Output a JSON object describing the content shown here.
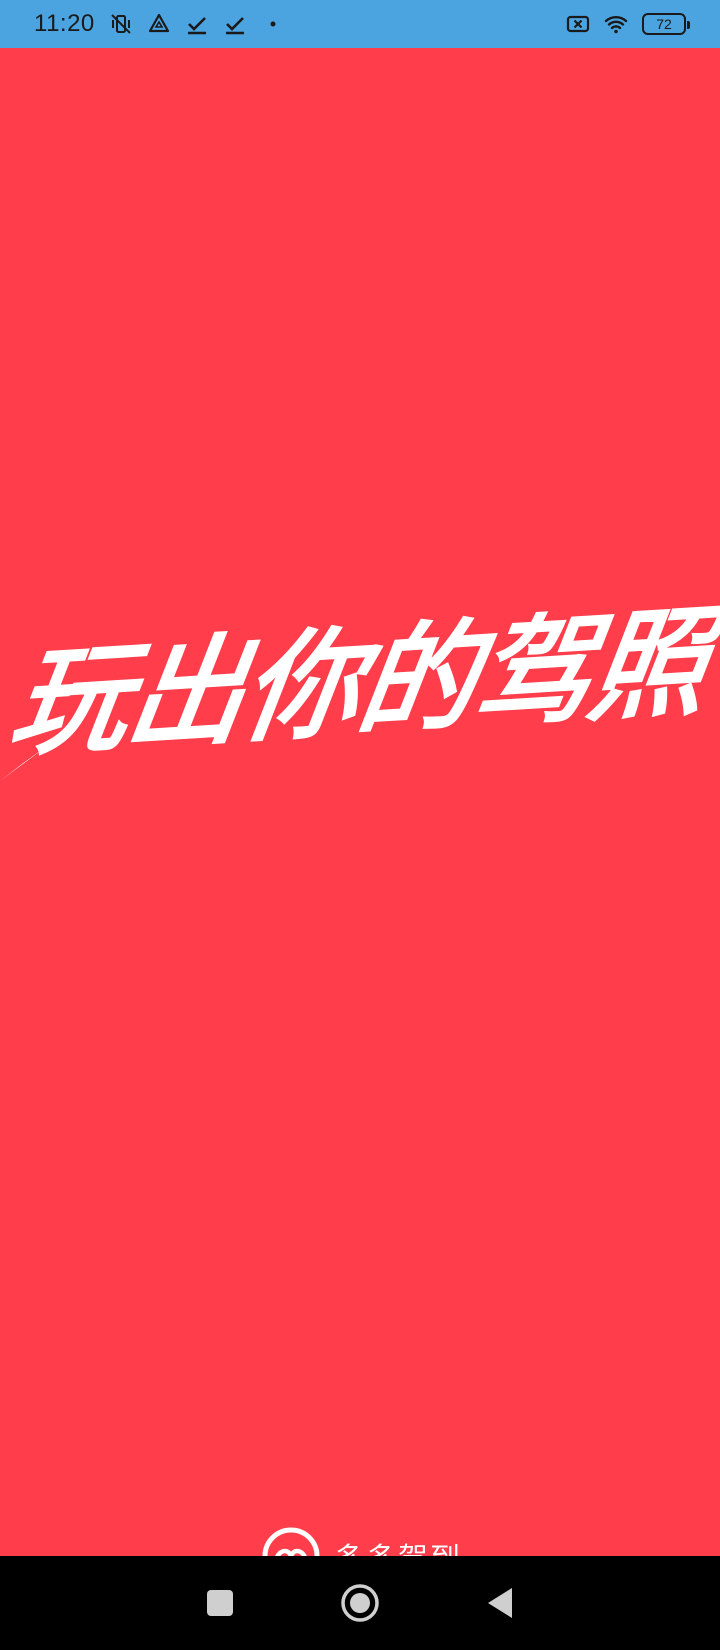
{
  "status_bar": {
    "time": "11:20",
    "battery_level": "72",
    "left_icons": [
      "vibrate-off-icon",
      "drive-icon",
      "check-icon",
      "check-icon",
      "dot-icon"
    ],
    "right_icons": [
      "sim-off-icon",
      "wifi-icon",
      "battery-icon"
    ]
  },
  "splash": {
    "background_color": "#ff3d4b",
    "slogan": "玩出你的驾照",
    "brand_name": "多多驾到"
  },
  "nav_bar": {
    "buttons": [
      "recents-button",
      "home-button",
      "back-button"
    ]
  }
}
